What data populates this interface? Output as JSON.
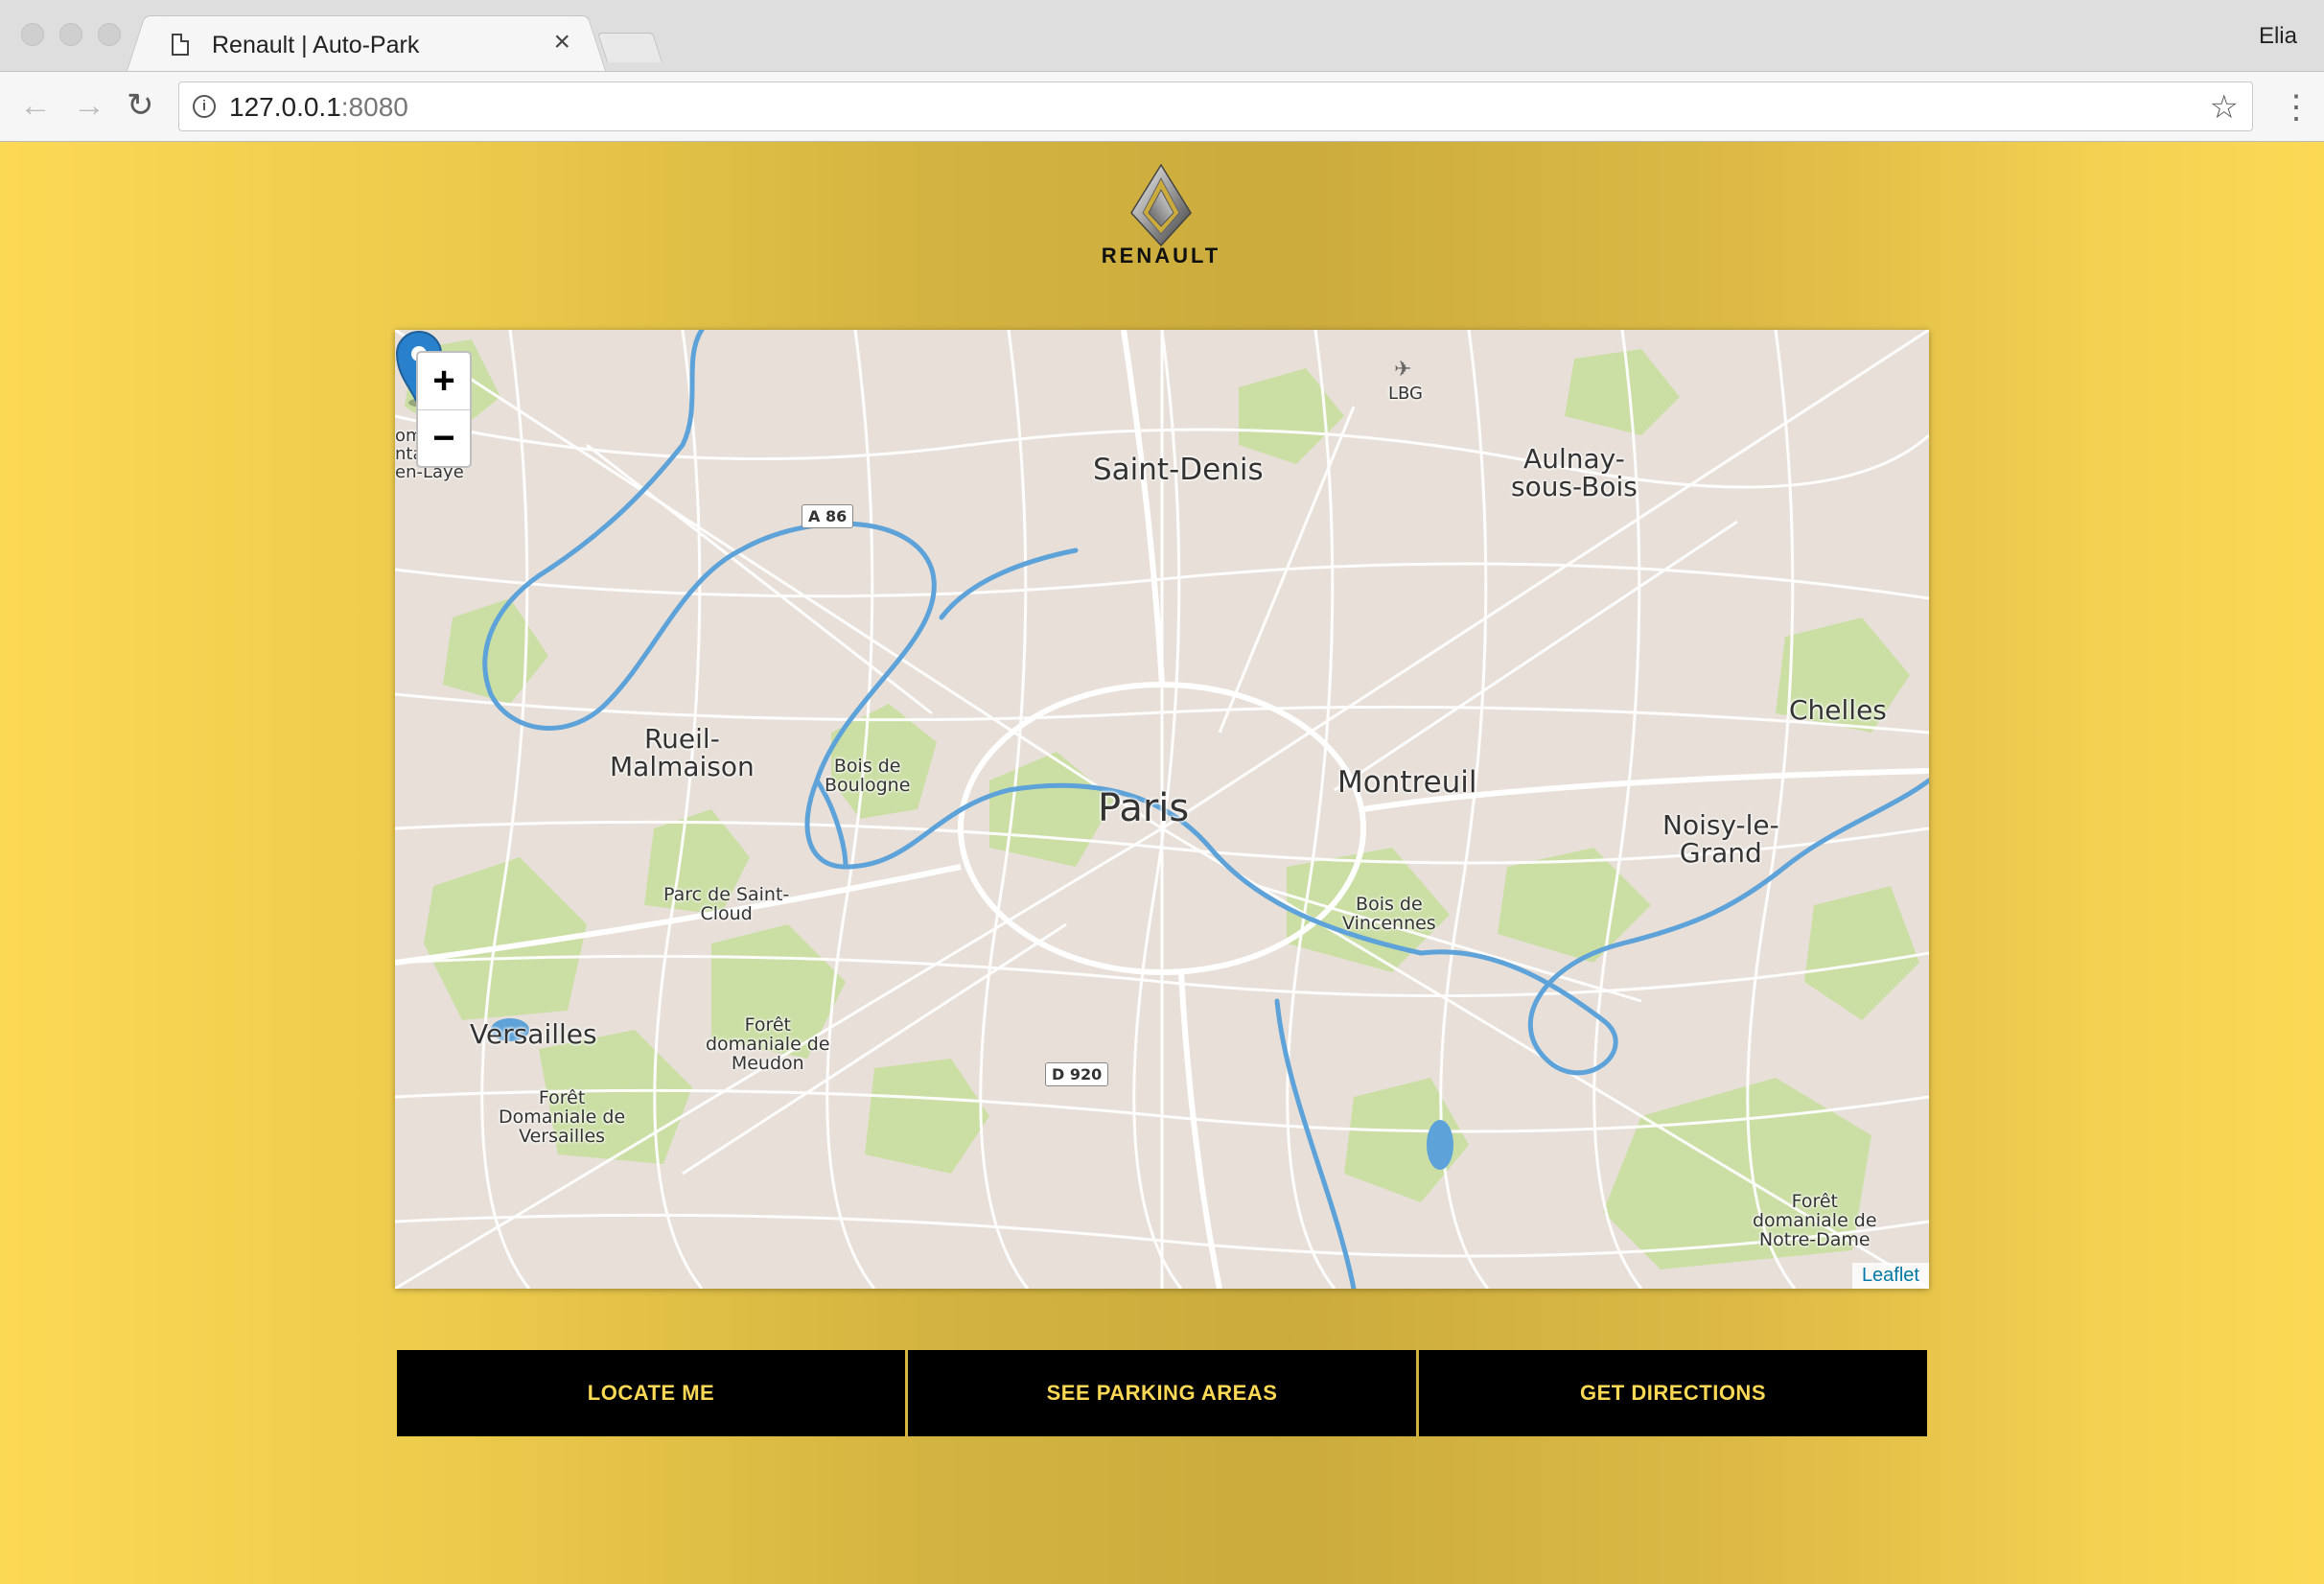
{
  "browser": {
    "tab_title": "Renault | Auto-Park",
    "tab_close": "×",
    "profile_name": "Elia",
    "url_host": "127.0.0.1",
    "url_port": ":8080",
    "back_icon": "←",
    "forward_icon": "→",
    "reload_icon": "↻",
    "star_icon": "☆",
    "menu_icon": "⋮",
    "info_icon": "i"
  },
  "header": {
    "brand": "RENAULT"
  },
  "map": {
    "zoom_in": "+",
    "zoom_out": "−",
    "attribution": "Leaflet",
    "labels": {
      "paris": "Paris",
      "saint_denis": "Saint-Denis",
      "aulnay_1": "Aulnay-",
      "aulnay_2": "sous-Bois",
      "montreuil": "Montreuil",
      "chelles": "Chelles",
      "noisy_1": "Noisy-le-",
      "noisy_2": "Grand",
      "rueil_1": "Rueil-",
      "rueil_2": "Malmaison",
      "versailles": "Versailles",
      "bois_boulogne_1": "Bois de",
      "bois_boulogne_2": "Boulogne",
      "bois_vincennes_1": "Bois de",
      "bois_vincennes_2": "Vincennes",
      "parc_stcloud_1": "Parc de Saint-",
      "parc_stcloud_2": "Cloud",
      "foret_meudon_1": "Forêt",
      "foret_meudon_2": "domaniale de",
      "foret_meudon_3": "Meudon",
      "foret_versailles_1": "Forêt",
      "foret_versailles_2": "Domaniale de",
      "foret_versailles_3": "Versailles",
      "foret_notre_dame_1": "Forêt",
      "foret_notre_dame_2": "domaniale de",
      "foret_notre_dame_3": "Notre-Dame",
      "lbg": "LBG",
      "st_germain_1": "om de",
      "st_germain_2": "ntain-",
      "st_germain_3": "en-Laye"
    },
    "shields": {
      "a86": "A 86",
      "d920": "D 920"
    },
    "colors": {
      "land": "#e8e0d8",
      "park": "#c8dfa0",
      "water": "#5da2d8",
      "road": "#ffffff"
    }
  },
  "actions": {
    "locate": "LOCATE ME",
    "parking": "SEE PARKING AREAS",
    "directions": "GET DIRECTIONS"
  }
}
